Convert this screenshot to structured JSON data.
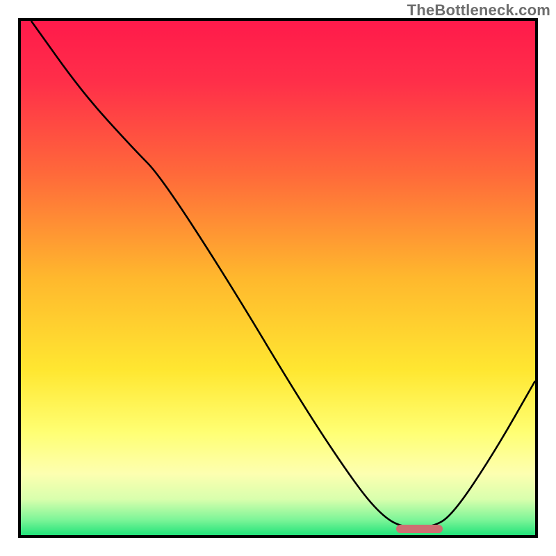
{
  "watermark": "TheBottleneck.com",
  "chart_data": {
    "type": "line",
    "title": "",
    "xlabel": "",
    "ylabel": "",
    "xlim": [
      0,
      100
    ],
    "ylim": [
      0,
      100
    ],
    "gradient_stops": [
      {
        "offset": 0.0,
        "color": "#ff1a4b"
      },
      {
        "offset": 0.12,
        "color": "#ff2f49"
      },
      {
        "offset": 0.3,
        "color": "#ff6a3a"
      },
      {
        "offset": 0.5,
        "color": "#ffb82d"
      },
      {
        "offset": 0.68,
        "color": "#ffe731"
      },
      {
        "offset": 0.8,
        "color": "#ffff73"
      },
      {
        "offset": 0.88,
        "color": "#fdffb0"
      },
      {
        "offset": 0.93,
        "color": "#d9ffad"
      },
      {
        "offset": 0.97,
        "color": "#7df598"
      },
      {
        "offset": 1.0,
        "color": "#22e37a"
      }
    ],
    "series": [
      {
        "name": "curve",
        "points": [
          {
            "x": 2.0,
            "y": 100.0
          },
          {
            "x": 12.0,
            "y": 86.0
          },
          {
            "x": 22.0,
            "y": 75.0
          },
          {
            "x": 27.0,
            "y": 70.0
          },
          {
            "x": 40.0,
            "y": 50.0
          },
          {
            "x": 55.0,
            "y": 25.0
          },
          {
            "x": 65.0,
            "y": 10.0
          },
          {
            "x": 70.0,
            "y": 4.0
          },
          {
            "x": 74.0,
            "y": 1.5
          },
          {
            "x": 80.0,
            "y": 1.5
          },
          {
            "x": 84.0,
            "y": 4.0
          },
          {
            "x": 92.0,
            "y": 16.0
          },
          {
            "x": 100.0,
            "y": 30.0
          }
        ]
      }
    ],
    "accent_bar": {
      "x_start": 73,
      "x_end": 82,
      "y": 1.2
    }
  }
}
